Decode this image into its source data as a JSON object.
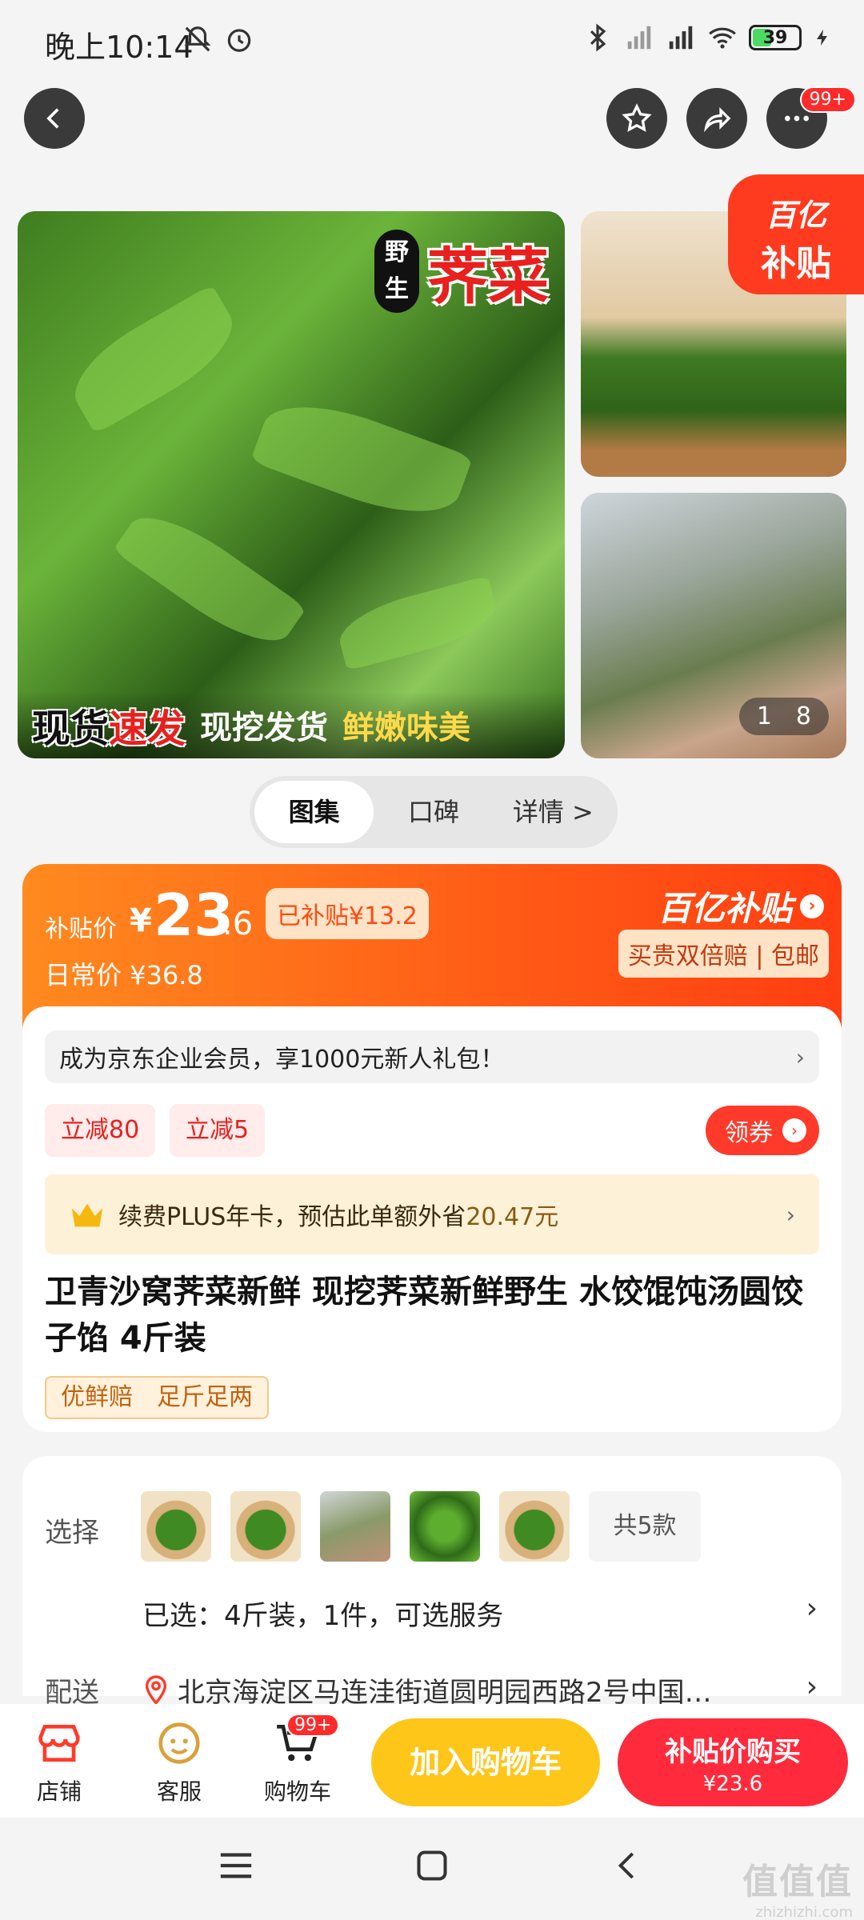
{
  "status_bar": {
    "time": "晚上10:14",
    "battery": "39"
  },
  "nav": {
    "more_badge": "99+"
  },
  "gallery": {
    "main_badge_wild": "野生",
    "main_title": "荠菜",
    "bottom_text_1a": "现货",
    "bottom_text_1b": "速发",
    "bottom_text_2": "现挖发货",
    "bottom_text_3": "鲜嫩味美",
    "corner_line1": "百亿",
    "corner_line2": "补贴",
    "counter_current": "1",
    "counter_total": "8"
  },
  "tabs": [
    {
      "label": "图集"
    },
    {
      "label": "口碑"
    },
    {
      "label": "详情 >"
    }
  ],
  "price": {
    "label": "补贴价",
    "currency": "¥",
    "integer": "23",
    "decimal": ".6",
    "saved": "已补贴¥13.2",
    "daily": "日常价 ¥36.8",
    "brand": "百亿补贴",
    "double": "买贵双倍赔 | 包邮"
  },
  "info": {
    "promo": "成为京东企业会员，享1000元新人礼包！",
    "chips": [
      "立减80",
      "立减5"
    ],
    "coupon": "领券",
    "plus_prefix": "续费PLUS年卡，预估此单额外省",
    "plus_amount": "20.47元",
    "title": "卫青沙窝荠菜新鲜 现挖荠菜新鲜野生 水饺馄饨汤圆饺子馅 4斤装",
    "guarantee": [
      "优鲜赔",
      "足斤足两"
    ]
  },
  "select": {
    "label": "选择",
    "variant_count": "共5款",
    "selected": "已选：4斤装，1件，可选服务",
    "delivery_label": "配送",
    "address": "北京海淀区马连洼街道圆明园西路2号中国…"
  },
  "bottom": {
    "store": "店铺",
    "service": "客服",
    "cart": "购物车",
    "cart_badge": "99+",
    "add_cart": "加入购物车",
    "buy_line1": "补贴价购买",
    "buy_line2": "¥23.6"
  },
  "watermark": {
    "line1": "值值值",
    "line2": "zhizhizhi.com"
  },
  "colors": {
    "accent_orange": "#ff5a16",
    "accent_red": "#ff2a3c",
    "cart_yellow": "#ffc61a"
  }
}
